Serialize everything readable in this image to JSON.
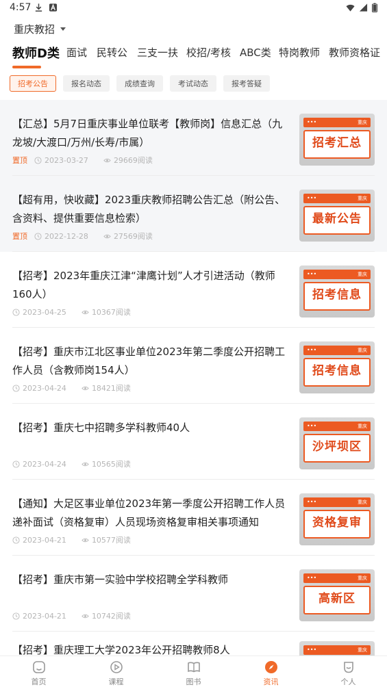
{
  "status": {
    "time": "4:57"
  },
  "header": {
    "region": "重庆教招"
  },
  "category_tabs": [
    {
      "label": "教师D类",
      "active": true
    },
    {
      "label": "面试"
    },
    {
      "label": "民转公"
    },
    {
      "label": "三支一扶"
    },
    {
      "label": "校招/考核"
    },
    {
      "label": "ABC类"
    },
    {
      "label": "特岗教师"
    },
    {
      "label": "教师资格证"
    }
  ],
  "sub_tabs": [
    {
      "label": "招考公告",
      "active": true
    },
    {
      "label": "报名动态"
    },
    {
      "label": "成绩查询"
    },
    {
      "label": "考试动态"
    },
    {
      "label": "报考答疑"
    }
  ],
  "articles": [
    {
      "title": "【汇总】5月7日重庆事业单位联考【教师岗】信息汇总（九龙坡/大渡口/万州/长寿/市属）",
      "pin": "置顶",
      "date": "2023-03-27",
      "views": "29669阅读",
      "thumb": "招考汇总",
      "pinned": true
    },
    {
      "title": "【超有用，快收藏】2023重庆教师招聘公告汇总（附公告、含资料、提供重要信息检索）",
      "pin": "置顶",
      "date": "2022-12-28",
      "views": "27569阅读",
      "thumb": "最新公告",
      "pinned": true
    },
    {
      "title": "【招考】2023年重庆江津“津鹰计划”人才引进活动（教师160人）",
      "date": "2023-04-25",
      "views": "10367阅读",
      "thumb": "招考信息"
    },
    {
      "title": "【招考】重庆市江北区事业单位2023年第二季度公开招聘工作人员（含教师岗154人）",
      "date": "2023-04-24",
      "views": "18421阅读",
      "thumb": "招考信息"
    },
    {
      "title": "【招考】重庆七中招聘多学科教师40人",
      "date": "2023-04-24",
      "views": "10565阅读",
      "thumb": "沙坪坝区"
    },
    {
      "title": "【通知】大足区事业单位2023年第一季度公开招聘工作人员递补面试（资格复审）人员现场资格复审相关事项通知",
      "date": "2023-04-21",
      "views": "10577阅读",
      "thumb": "资格复审"
    },
    {
      "title": "【招考】重庆市第一实验中学校招聘全学科教师",
      "date": "2023-04-21",
      "views": "10742阅读",
      "thumb": "高新区"
    },
    {
      "title": "【招考】重庆理工大学2023年公开招聘教师8人",
      "date": "",
      "views": "",
      "thumb": ""
    }
  ],
  "bottom_nav": [
    {
      "label": "首页",
      "icon": "home-icon"
    },
    {
      "label": "课程",
      "icon": "play-circle-icon"
    },
    {
      "label": "图书",
      "icon": "book-icon"
    },
    {
      "label": "资讯",
      "icon": "compass-icon",
      "active": true
    },
    {
      "label": "个人",
      "icon": "user-icon"
    }
  ],
  "colors": {
    "accent": "#f06a29",
    "thumb_red": "#ec5a22"
  }
}
